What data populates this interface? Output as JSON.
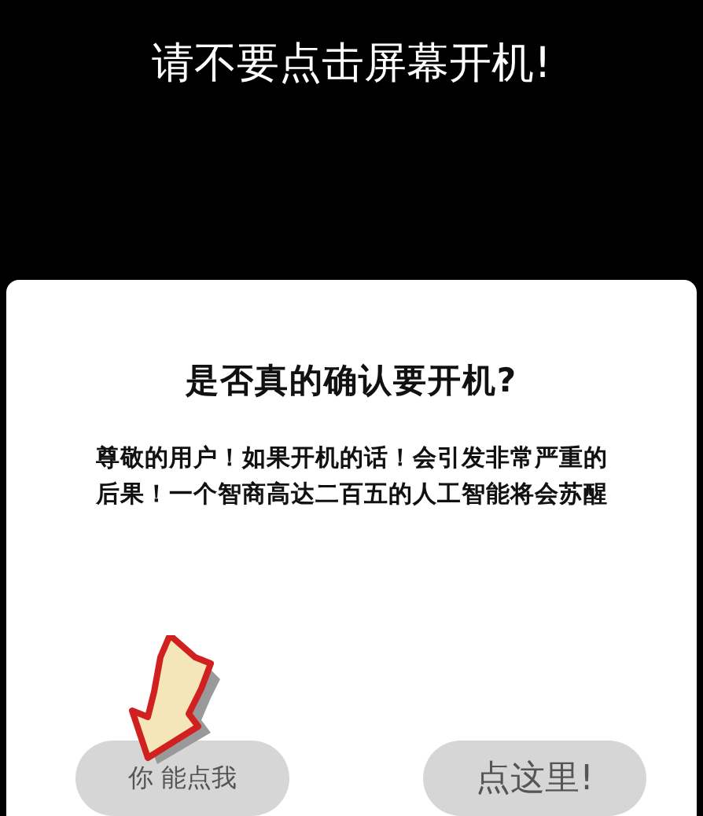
{
  "screen_title": "请不要点击屏幕开机!",
  "dialog": {
    "title": "是否真的确认要开机?",
    "message": "尊敬的用户！如果开机的话！会引发非常严重的后果！一个智商高达二百五的人工智能将会苏醒",
    "buttons": [
      {
        "label": "你 能点我",
        "kind": "small"
      },
      {
        "label": "点这里!",
        "kind": "large"
      }
    ]
  }
}
